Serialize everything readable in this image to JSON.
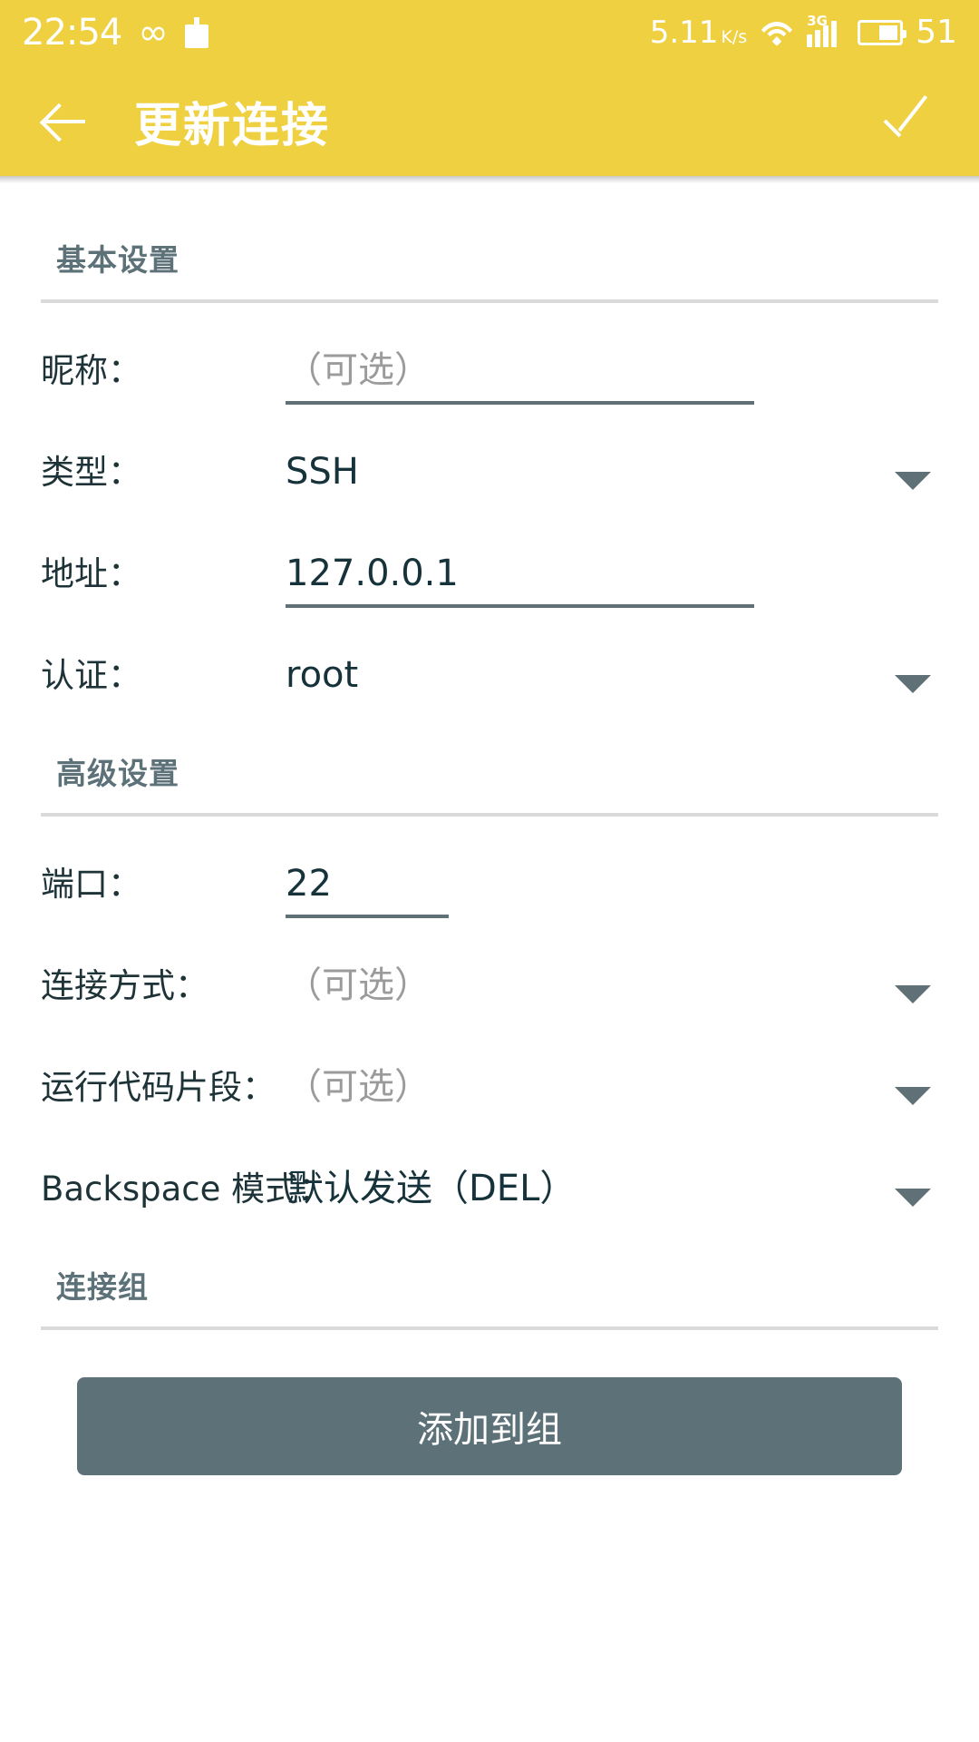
{
  "status_bar": {
    "time": "22:54",
    "infinity_icon": "infinity-icon",
    "clipboard_icon": "clipboard-icon",
    "network_speed": "5.11",
    "network_speed_unit": "K/s",
    "speed_unit_numerator": "K",
    "speed_unit_denominator": "s",
    "wifi_icon": "wifi-icon",
    "network_type": "3G",
    "signal_icon": "signal-bars-icon",
    "battery_icon": "battery-icon",
    "battery_level": "51"
  },
  "app_bar": {
    "back_label": "back-arrow",
    "title": "更新连接",
    "confirm_label": "check-icon",
    "background_color": "#efd040",
    "foreground_color": "#ffffff"
  },
  "sections": {
    "basic": {
      "title": "基本设置",
      "rows": {
        "nickname": {
          "label": "昵称：",
          "value": "（可选）",
          "is_placeholder": true
        },
        "type": {
          "label": "类型：",
          "value": "SSH",
          "is_placeholder": false
        },
        "address": {
          "label": "地址：",
          "value": "127.0.0.1",
          "is_placeholder": false
        },
        "auth": {
          "label": "认证：",
          "value": "root",
          "is_placeholder": false
        }
      }
    },
    "advanced": {
      "title": "高级设置",
      "rows": {
        "port": {
          "label": "端口：",
          "value": "22",
          "is_placeholder": false
        },
        "connection_method": {
          "label": "连接方式：",
          "value": "（可选）",
          "is_placeholder": true
        },
        "run_snippet": {
          "label": "运行代码片段：",
          "value": "（可选）",
          "is_placeholder": true
        },
        "backspace_mode": {
          "label": "Backspace 模式：",
          "value": "默认发送（DEL）",
          "is_placeholder": false
        }
      }
    },
    "group": {
      "title": "连接组",
      "add_button_label": "添加到组"
    }
  },
  "colors": {
    "accent": "#efd040",
    "label_text": "#1e3338",
    "section_header": "#5d7179",
    "placeholder": "#9b9b9b",
    "underline": "#5f7076",
    "button": "#5d7179",
    "divider": "#dadada"
  }
}
